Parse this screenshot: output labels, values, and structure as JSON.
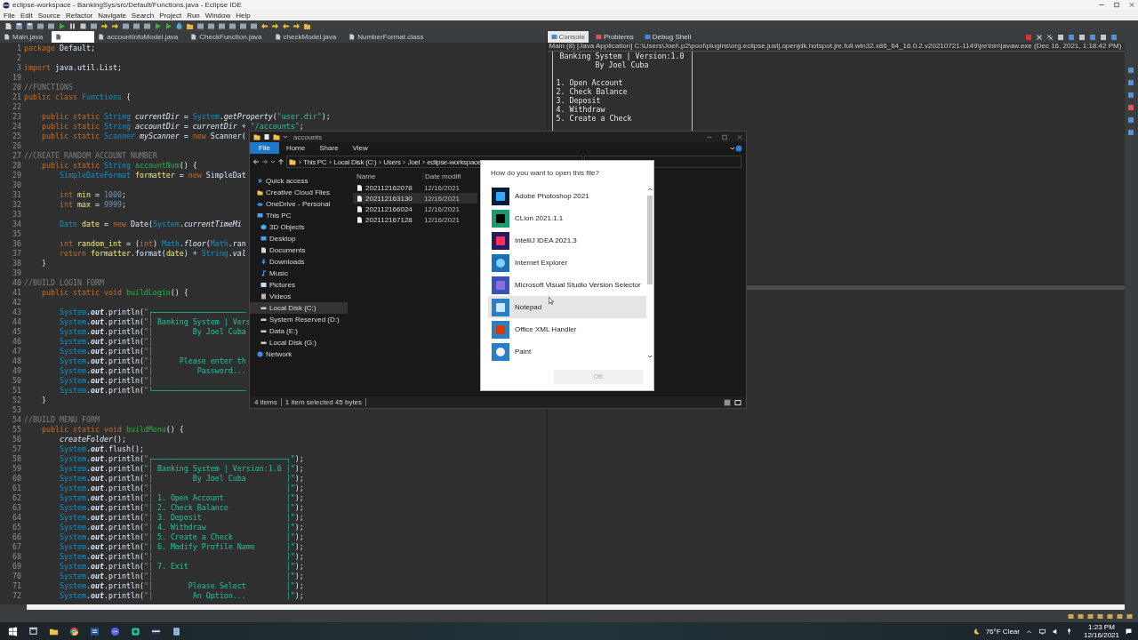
{
  "title_bar": {
    "title": "eclipse-workspace - BankingSys/src/Default/Functions.java - Eclipse IDE"
  },
  "menu": [
    "File",
    "Edit",
    "Source",
    "Refactor",
    "Navigate",
    "Search",
    "Project",
    "Run",
    "Window",
    "Help"
  ],
  "editor": {
    "tabs": [
      {
        "label": "Main.java",
        "selected": false
      },
      {
        "selected": true
      },
      {
        "label": "accountInfoModel.java",
        "selected": false
      },
      {
        "label": "CheckFunction.java",
        "selected": false
      },
      {
        "label": "checkModel.java",
        "selected": false
      },
      {
        "label": "NumberFormat.class",
        "selected": false
      }
    ],
    "lines": [
      {
        "n": "1",
        "parts": [
          {
            "kind": "kw",
            "text": "package"
          },
          {
            "kind": "plain",
            "text": " Default;"
          }
        ]
      },
      {
        "n": "2"
      },
      {
        "n": "3",
        "parts": [
          {
            "kind": "kw",
            "text": "import"
          },
          {
            "kind": "plain",
            "text": " java.util.List;"
          }
        ]
      },
      {
        "n": "19"
      },
      {
        "n": "20",
        "parts": [
          {
            "kind": "com",
            "text": "//FUNCTIONS"
          }
        ]
      },
      {
        "n": "21",
        "parts": [
          {
            "kind": "kw",
            "text": "public class "
          },
          {
            "kind": "type",
            "text": "Functions"
          },
          {
            "kind": "plain",
            "text": " {"
          }
        ]
      },
      {
        "n": "22"
      },
      {
        "n": "23",
        "parts": [
          {
            "kind": "kw",
            "text": "    public static "
          },
          {
            "kind": "type",
            "text": "String "
          },
          {
            "kind": "ital",
            "text": "currentDir"
          },
          {
            "kind": "plain",
            "text": " = "
          },
          {
            "kind": "type",
            "text": "System"
          },
          {
            "kind": "plain",
            "text": "."
          },
          {
            "kind": "ital",
            "text": "getProperty"
          },
          {
            "kind": "plain",
            "text": "("
          },
          {
            "kind": "str",
            "text": "\"user.dir\""
          },
          {
            "kind": "plain",
            "text": ");"
          }
        ]
      },
      {
        "n": "24",
        "parts": [
          {
            "kind": "kw",
            "text": "    public static "
          },
          {
            "kind": "type",
            "text": "String "
          },
          {
            "kind": "ital",
            "text": "accountDir"
          },
          {
            "kind": "plain",
            "text": " = "
          },
          {
            "kind": "ital",
            "text": "currentDir"
          },
          {
            "kind": "plain",
            "text": " + "
          },
          {
            "kind": "str",
            "text": "\"/accounts\""
          },
          {
            "kind": "plain",
            "text": ";"
          }
        ]
      },
      {
        "n": "25",
        "parts": [
          {
            "kind": "kw",
            "text": "    public static "
          },
          {
            "kind": "type",
            "text": "Scanner "
          },
          {
            "kind": "ital",
            "text": "myScanner"
          },
          {
            "kind": "plain",
            "text": " = "
          },
          {
            "kind": "kw",
            "text": "new "
          },
          {
            "kind": "plain",
            "text": "Scanner("
          }
        ]
      },
      {
        "n": "26"
      },
      {
        "n": "27",
        "parts": [
          {
            "kind": "com",
            "text": "//CREATE RANDOM ACCOUNT NUMBER"
          }
        ]
      },
      {
        "n": "28",
        "parts": [
          {
            "kind": "kw",
            "text": "    public static "
          },
          {
            "kind": "type",
            "text": "String "
          },
          {
            "kind": "meth",
            "text": "accountNum"
          },
          {
            "kind": "plain",
            "text": "() {"
          }
        ]
      },
      {
        "n": "29",
        "parts": [
          {
            "kind": "type",
            "text": "        SimpleDateFormat "
          },
          {
            "kind": "local",
            "text": "formatter"
          },
          {
            "kind": "plain",
            "text": " = "
          },
          {
            "kind": "kw",
            "text": "new "
          },
          {
            "kind": "plain",
            "text": "SimpleDat"
          }
        ]
      },
      {
        "n": "30"
      },
      {
        "n": "31",
        "parts": [
          {
            "kind": "kw",
            "text": "        int "
          },
          {
            "kind": "local",
            "text": "min"
          },
          {
            "kind": "plain",
            "text": " = "
          },
          {
            "kind": "num",
            "text": "1000"
          },
          {
            "kind": "plain",
            "text": ";"
          }
        ]
      },
      {
        "n": "32",
        "parts": [
          {
            "kind": "kw",
            "text": "        int "
          },
          {
            "kind": "local",
            "text": "max"
          },
          {
            "kind": "plain",
            "text": " = "
          },
          {
            "kind": "num",
            "text": "9999"
          },
          {
            "kind": "plain",
            "text": ";"
          }
        ]
      },
      {
        "n": "33"
      },
      {
        "n": "34",
        "parts": [
          {
            "kind": "type",
            "text": "        Date "
          },
          {
            "kind": "local",
            "text": "date"
          },
          {
            "kind": "plain",
            "text": " = "
          },
          {
            "kind": "kw",
            "text": "new "
          },
          {
            "kind": "plain",
            "text": "Date("
          },
          {
            "kind": "type",
            "text": "System"
          },
          {
            "kind": "plain",
            "text": "."
          },
          {
            "kind": "ital",
            "text": "currentTimeMi"
          }
        ]
      },
      {
        "n": "35"
      },
      {
        "n": "36",
        "parts": [
          {
            "kind": "kw",
            "text": "        int "
          },
          {
            "kind": "local",
            "text": "random_int"
          },
          {
            "kind": "plain",
            "text": " = ("
          },
          {
            "kind": "kw",
            "text": "int"
          },
          {
            "kind": "plain",
            "text": ") "
          },
          {
            "kind": "type",
            "text": "Math"
          },
          {
            "kind": "plain",
            "text": "."
          },
          {
            "kind": "ital",
            "text": "floor"
          },
          {
            "kind": "plain",
            "text": "("
          },
          {
            "kind": "type",
            "text": "Math"
          },
          {
            "kind": "plain",
            "text": ".ran"
          }
        ]
      },
      {
        "n": "37",
        "parts": [
          {
            "kind": "kw",
            "text": "        return "
          },
          {
            "kind": "local",
            "text": "formatter"
          },
          {
            "kind": "plain",
            "text": ".format("
          },
          {
            "kind": "local",
            "text": "date"
          },
          {
            "kind": "plain",
            "text": ") + "
          },
          {
            "kind": "type",
            "text": "String"
          },
          {
            "kind": "plain",
            "text": "."
          },
          {
            "kind": "ital",
            "text": "val"
          }
        ]
      },
      {
        "n": "38",
        "parts": [
          {
            "kind": "plain",
            "text": "    }"
          }
        ]
      },
      {
        "n": "39"
      },
      {
        "n": "40",
        "parts": [
          {
            "kind": "com",
            "text": "//BUILD LOGIN FORM"
          }
        ]
      },
      {
        "n": "41",
        "parts": [
          {
            "kind": "kw",
            "text": "    public static void "
          },
          {
            "kind": "meth",
            "text": "buildLogin"
          },
          {
            "kind": "plain",
            "text": "() {"
          }
        ]
      },
      {
        "n": "42"
      },
      {
        "n": "43",
        "parts": [
          {
            "kind": "type",
            "text": "        System"
          },
          {
            "kind": "plain",
            "text": "."
          },
          {
            "kind": "bital",
            "text": "out"
          },
          {
            "kind": "plain",
            "text": ".println("
          },
          {
            "kind": "str",
            "text": "\"┌─────────────────────"
          }
        ]
      },
      {
        "n": "44",
        "parts": [
          {
            "kind": "type",
            "text": "        System"
          },
          {
            "kind": "plain",
            "text": "."
          },
          {
            "kind": "bital",
            "text": "out"
          },
          {
            "kind": "plain",
            "text": ".println("
          },
          {
            "kind": "str",
            "text": "\"│ Banking System | Vers"
          }
        ]
      },
      {
        "n": "45",
        "parts": [
          {
            "kind": "type",
            "text": "        System"
          },
          {
            "kind": "plain",
            "text": "."
          },
          {
            "kind": "bital",
            "text": "out"
          },
          {
            "kind": "plain",
            "text": ".println("
          },
          {
            "kind": "str",
            "text": "\"│         By Joel Cuba"
          }
        ]
      },
      {
        "n": "46",
        "parts": [
          {
            "kind": "type",
            "text": "        System"
          },
          {
            "kind": "plain",
            "text": "."
          },
          {
            "kind": "bital",
            "text": "out"
          },
          {
            "kind": "plain",
            "text": ".println("
          },
          {
            "kind": "str",
            "text": "\"│"
          }
        ]
      },
      {
        "n": "47",
        "parts": [
          {
            "kind": "type",
            "text": "        System"
          },
          {
            "kind": "plain",
            "text": "."
          },
          {
            "kind": "bital",
            "text": "out"
          },
          {
            "kind": "plain",
            "text": ".println("
          },
          {
            "kind": "str",
            "text": "\"│"
          }
        ]
      },
      {
        "n": "48",
        "parts": [
          {
            "kind": "type",
            "text": "        System"
          },
          {
            "kind": "plain",
            "text": "."
          },
          {
            "kind": "bital",
            "text": "out"
          },
          {
            "kind": "plain",
            "text": ".println("
          },
          {
            "kind": "str",
            "text": "\"│      Please enter th"
          }
        ]
      },
      {
        "n": "49",
        "parts": [
          {
            "kind": "type",
            "text": "        System"
          },
          {
            "kind": "plain",
            "text": "."
          },
          {
            "kind": "bital",
            "text": "out"
          },
          {
            "kind": "plain",
            "text": ".println("
          },
          {
            "kind": "str",
            "text": "\"│          Password..."
          }
        ]
      },
      {
        "n": "50",
        "parts": [
          {
            "kind": "type",
            "text": "        System"
          },
          {
            "kind": "plain",
            "text": "."
          },
          {
            "kind": "bital",
            "text": "out"
          },
          {
            "kind": "plain",
            "text": ".println("
          },
          {
            "kind": "str",
            "text": "\"│"
          }
        ]
      },
      {
        "n": "51",
        "parts": [
          {
            "kind": "type",
            "text": "        System"
          },
          {
            "kind": "plain",
            "text": "."
          },
          {
            "kind": "bital",
            "text": "out"
          },
          {
            "kind": "plain",
            "text": ".println("
          },
          {
            "kind": "str",
            "text": "\"└─────────────────────"
          }
        ]
      },
      {
        "n": "52",
        "parts": [
          {
            "kind": "plain",
            "text": "    }"
          }
        ]
      },
      {
        "n": "53"
      },
      {
        "n": "54",
        "parts": [
          {
            "kind": "com",
            "text": "//BUILD MENU FORM"
          }
        ]
      },
      {
        "n": "55",
        "parts": [
          {
            "kind": "kw",
            "text": "    public static void "
          },
          {
            "kind": "meth",
            "text": "buildMenu"
          },
          {
            "kind": "plain",
            "text": "() {"
          }
        ]
      },
      {
        "n": "56",
        "parts": [
          {
            "kind": "ital",
            "text": "        createFolder"
          },
          {
            "kind": "plain",
            "text": "();"
          }
        ]
      },
      {
        "n": "57",
        "parts": [
          {
            "kind": "type",
            "text": "        System"
          },
          {
            "kind": "plain",
            "text": "."
          },
          {
            "kind": "bital",
            "text": "out"
          },
          {
            "kind": "plain",
            "text": ".flush();"
          }
        ]
      },
      {
        "n": "58",
        "parts": [
          {
            "kind": "type",
            "text": "        System"
          },
          {
            "kind": "plain",
            "text": "."
          },
          {
            "kind": "bital",
            "text": "out"
          },
          {
            "kind": "plain",
            "text": ".println("
          },
          {
            "kind": "str",
            "text": "\"┌──────────────────────────────┐\""
          },
          {
            "kind": "plain",
            "text": ");"
          }
        ]
      },
      {
        "n": "59",
        "parts": [
          {
            "kind": "type",
            "text": "        System"
          },
          {
            "kind": "plain",
            "text": "."
          },
          {
            "kind": "bital",
            "text": "out"
          },
          {
            "kind": "plain",
            "text": ".println("
          },
          {
            "kind": "str",
            "text": "\"│ Banking System | Version:1.0 │\""
          },
          {
            "kind": "plain",
            "text": ");"
          }
        ]
      },
      {
        "n": "60",
        "parts": [
          {
            "kind": "type",
            "text": "        System"
          },
          {
            "kind": "plain",
            "text": "."
          },
          {
            "kind": "bital",
            "text": "out"
          },
          {
            "kind": "plain",
            "text": ".println("
          },
          {
            "kind": "str",
            "text": "\"│         By Joel Cuba         │\""
          },
          {
            "kind": "plain",
            "text": ");"
          }
        ]
      },
      {
        "n": "61",
        "parts": [
          {
            "kind": "type",
            "text": "        System"
          },
          {
            "kind": "plain",
            "text": "."
          },
          {
            "kind": "bital",
            "text": "out"
          },
          {
            "kind": "plain",
            "text": ".println("
          },
          {
            "kind": "str",
            "text": "\"│                              │\""
          },
          {
            "kind": "plain",
            "text": ");"
          }
        ]
      },
      {
        "n": "62",
        "parts": [
          {
            "kind": "type",
            "text": "        System"
          },
          {
            "kind": "plain",
            "text": "."
          },
          {
            "kind": "bital",
            "text": "out"
          },
          {
            "kind": "plain",
            "text": ".println("
          },
          {
            "kind": "str",
            "text": "\"│ 1. Open Account              │\""
          },
          {
            "kind": "plain",
            "text": ");"
          }
        ]
      },
      {
        "n": "63",
        "parts": [
          {
            "kind": "type",
            "text": "        System"
          },
          {
            "kind": "plain",
            "text": "."
          },
          {
            "kind": "bital",
            "text": "out"
          },
          {
            "kind": "plain",
            "text": ".println("
          },
          {
            "kind": "str",
            "text": "\"│ 2. Check Balance             │\""
          },
          {
            "kind": "plain",
            "text": ");"
          }
        ]
      },
      {
        "n": "64",
        "parts": [
          {
            "kind": "type",
            "text": "        System"
          },
          {
            "kind": "plain",
            "text": "."
          },
          {
            "kind": "bital",
            "text": "out"
          },
          {
            "kind": "plain",
            "text": ".println("
          },
          {
            "kind": "str",
            "text": "\"│ 3. Deposit                   │\""
          },
          {
            "kind": "plain",
            "text": ");"
          }
        ]
      },
      {
        "n": "65",
        "parts": [
          {
            "kind": "type",
            "text": "        System"
          },
          {
            "kind": "plain",
            "text": "."
          },
          {
            "kind": "bital",
            "text": "out"
          },
          {
            "kind": "plain",
            "text": ".println("
          },
          {
            "kind": "str",
            "text": "\"│ 4. Withdraw                  │\""
          },
          {
            "kind": "plain",
            "text": ");"
          }
        ]
      },
      {
        "n": "66",
        "parts": [
          {
            "kind": "type",
            "text": "        System"
          },
          {
            "kind": "plain",
            "text": "."
          },
          {
            "kind": "bital",
            "text": "out"
          },
          {
            "kind": "plain",
            "text": ".println("
          },
          {
            "kind": "str",
            "text": "\"│ 5. Create a Check            │\""
          },
          {
            "kind": "plain",
            "text": ");"
          }
        ]
      },
      {
        "n": "67",
        "parts": [
          {
            "kind": "type",
            "text": "        System"
          },
          {
            "kind": "plain",
            "text": "."
          },
          {
            "kind": "bital",
            "text": "out"
          },
          {
            "kind": "plain",
            "text": ".println("
          },
          {
            "kind": "str",
            "text": "\"│ 6. Modify Profile Name       │\""
          },
          {
            "kind": "plain",
            "text": ");"
          }
        ]
      },
      {
        "n": "68",
        "parts": [
          {
            "kind": "type",
            "text": "        System"
          },
          {
            "kind": "plain",
            "text": "."
          },
          {
            "kind": "bital",
            "text": "out"
          },
          {
            "kind": "plain",
            "text": ".println("
          },
          {
            "kind": "str",
            "text": "\"│                              │\""
          },
          {
            "kind": "plain",
            "text": ");"
          }
        ]
      },
      {
        "n": "69",
        "parts": [
          {
            "kind": "type",
            "text": "        System"
          },
          {
            "kind": "plain",
            "text": "."
          },
          {
            "kind": "bital",
            "text": "out"
          },
          {
            "kind": "plain",
            "text": ".println("
          },
          {
            "kind": "str",
            "text": "\"│ 7. Exit                      │\""
          },
          {
            "kind": "plain",
            "text": ");"
          }
        ]
      },
      {
        "n": "70",
        "parts": [
          {
            "kind": "type",
            "text": "        System"
          },
          {
            "kind": "plain",
            "text": "."
          },
          {
            "kind": "bital",
            "text": "out"
          },
          {
            "kind": "plain",
            "text": ".println("
          },
          {
            "kind": "str",
            "text": "\"│                              │\""
          },
          {
            "kind": "plain",
            "text": ");"
          }
        ]
      },
      {
        "n": "71",
        "parts": [
          {
            "kind": "type",
            "text": "        System"
          },
          {
            "kind": "plain",
            "text": "."
          },
          {
            "kind": "bital",
            "text": "out"
          },
          {
            "kind": "plain",
            "text": ".println("
          },
          {
            "kind": "str",
            "text": "\"│        Please Select         │\""
          },
          {
            "kind": "plain",
            "text": ");"
          }
        ]
      },
      {
        "n": "72",
        "parts": [
          {
            "kind": "type",
            "text": "        System"
          },
          {
            "kind": "plain",
            "text": "."
          },
          {
            "kind": "bital",
            "text": "out"
          },
          {
            "kind": "plain",
            "text": ".println("
          },
          {
            "kind": "str",
            "text": "\"│         An Option...         │\""
          },
          {
            "kind": "plain",
            "text": ");"
          }
        ]
      }
    ]
  },
  "console": {
    "tabs": [
      {
        "label": "Console",
        "selected": true
      },
      {
        "label": "Problems",
        "selected": false
      },
      {
        "label": "Debug Shell",
        "selected": false
      }
    ],
    "launch": "Main (8) [Java Application] C:\\Users\\Joel\\.p2\\pool\\plugins\\org.eclipse.justj.openjdk.hotspot.jre.full.win32.x86_64_16.0.2.v20210721-1149\\jre\\bin\\javaw.exe  (Dec 16, 2021, 1:18:42 PM)",
    "header": [
      "Banking System | Version:1.0",
      "By Joel Cuba"
    ],
    "options": [
      "1. Open Account",
      "2. Check Balance",
      "3. Deposit",
      "4. Withdraw",
      "5. Create a Check"
    ]
  },
  "explorer": {
    "title": "accounts",
    "ribbon_tabs": [
      {
        "label": "File",
        "selected": true
      },
      {
        "label": "Home",
        "selected": false
      },
      {
        "label": "Share",
        "selected": false
      },
      {
        "label": "View",
        "selected": false
      }
    ],
    "breadcrumb": [
      "This PC",
      "Local Disk (C:)",
      "Users",
      "Joel",
      "eclipse-workspace"
    ],
    "nav": [
      {
        "label": "Quick access",
        "selected": false
      },
      {
        "label": "Creative Cloud Files",
        "selected": false
      },
      {
        "label": "OneDrive - Personal",
        "selected": false
      },
      {
        "label": "This PC",
        "selected": false,
        "children": [
          {
            "label": "3D Objects",
            "selected": false
          },
          {
            "label": "Desktop",
            "selected": false
          },
          {
            "label": "Documents",
            "selected": false
          },
          {
            "label": "Downloads",
            "selected": false
          },
          {
            "label": "Music",
            "selected": false
          },
          {
            "label": "Pictures",
            "selected": false
          },
          {
            "label": "Videos",
            "selected": false
          },
          {
            "label": "Local Disk (C:)",
            "selected": true
          },
          {
            "label": "System Reserved (D:)",
            "selected": false
          },
          {
            "label": "Data (E:)",
            "selected": false
          },
          {
            "label": "Local Disk (G:)",
            "selected": false
          }
        ]
      },
      {
        "label": "Network",
        "selected": false
      }
    ],
    "columns": [
      "Name",
      "Date modifi"
    ],
    "files": [
      {
        "name": "202112162078",
        "date": "12/16/2021",
        "selected": false
      },
      {
        "name": "202112163130",
        "date": "12/16/2021",
        "selected": true
      },
      {
        "name": "202112166024",
        "date": "12/16/2021",
        "selected": false
      },
      {
        "name": "202112167128",
        "date": "12/16/2021",
        "selected": false
      }
    ],
    "status": [
      "4 items",
      "1 item selected  45 bytes"
    ]
  },
  "open_with": {
    "prompt": "How do you want to open this file?",
    "apps": [
      {
        "name": "Adobe Photoshop 2021",
        "selected": false
      },
      {
        "name": "CLion 2021.1.1",
        "selected": false
      },
      {
        "name": "IntelliJ IDEA 2021.3",
        "selected": false
      },
      {
        "name": "Internet Explorer",
        "selected": false
      },
      {
        "name": "Microsoft Visual Studio Version Selector",
        "selected": false
      },
      {
        "name": "Notepad",
        "selected": true
      },
      {
        "name": "Office XML Handler",
        "selected": false
      },
      {
        "name": "Paint",
        "selected": false
      }
    ],
    "ok_button": {
      "label": "OK",
      "disabled": true
    }
  },
  "taskbar": {
    "weather": "76°F  Clear",
    "time": "1:23 PM",
    "date": "12/16/2021"
  }
}
